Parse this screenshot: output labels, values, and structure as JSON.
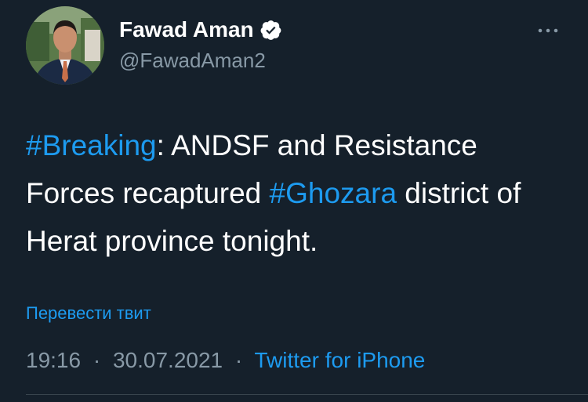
{
  "tweet": {
    "author": {
      "name": "Fawad Aman",
      "handle": "@FawadAman2",
      "verified_icon": "verified-badge-icon"
    },
    "text_segments": [
      {
        "text": "#Breaking",
        "type": "hashtag"
      },
      {
        "text": ": ANDSF and Resistance Forces recaptured ",
        "type": "text"
      },
      {
        "text": "#Ghozara",
        "type": "hashtag"
      },
      {
        "text": " district of Herat province tonight.",
        "type": "text"
      }
    ],
    "translate_label": "Перевести твит",
    "time": "19:16",
    "separator": "·",
    "date": "30.07.2021",
    "source": "Twitter for iPhone"
  },
  "colors": {
    "background": "#15202b",
    "text": "#ffffff",
    "secondary_text": "#8899a6",
    "link": "#1d9bf0",
    "divider": "#38444d"
  }
}
